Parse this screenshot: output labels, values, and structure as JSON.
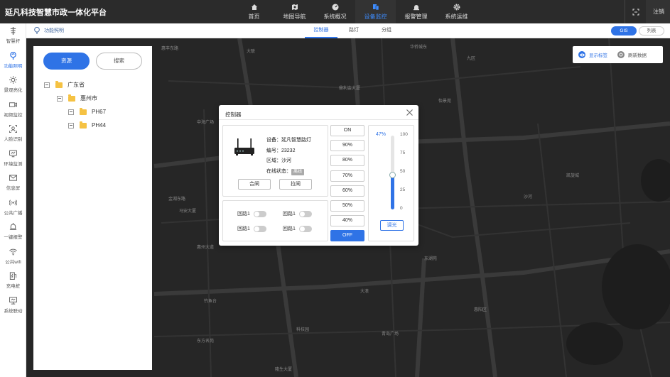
{
  "app": {
    "title": "延凡科技智慧市政一体化平台"
  },
  "nav": {
    "items": [
      {
        "label": "首页",
        "icon": "home-icon"
      },
      {
        "label": "地图导航",
        "icon": "map-pin-icon"
      },
      {
        "label": "系统概况",
        "icon": "gauge-icon"
      },
      {
        "label": "设备监控",
        "icon": "device-icon",
        "active": true
      },
      {
        "label": "报警管理",
        "icon": "alarm-icon"
      },
      {
        "label": "系统运维",
        "icon": "gear-icon"
      }
    ],
    "logout_label": "注销"
  },
  "sidebar": {
    "items": [
      {
        "label": "智慧杆",
        "icon": "pole-icon"
      },
      {
        "label": "功能照明",
        "icon": "lamp-icon",
        "active": true
      },
      {
        "label": "景观亮化",
        "icon": "sun-icon"
      },
      {
        "label": "视频监控",
        "icon": "camera-icon"
      },
      {
        "label": "人脸识别",
        "icon": "face-icon"
      },
      {
        "label": "环境监测",
        "icon": "monitor-icon"
      },
      {
        "label": "信息屏",
        "icon": "mail-icon"
      },
      {
        "label": "公共广播",
        "icon": "broadcast-icon"
      },
      {
        "label": "一键报警",
        "icon": "bell-icon"
      },
      {
        "label": "公共wifi",
        "icon": "wifi-icon"
      },
      {
        "label": "充电桩",
        "icon": "charger-icon"
      },
      {
        "label": "系统联动",
        "icon": "link-icon"
      }
    ]
  },
  "subbar": {
    "breadcrumb": "功能照明",
    "tabs": [
      {
        "label": "控制器",
        "active": true
      },
      {
        "label": "路灯"
      },
      {
        "label": "分组"
      }
    ],
    "view_gis": "GIS",
    "view_list": "列表"
  },
  "tree_panel": {
    "btn_resource": "资源",
    "btn_search": "搜索",
    "province": "广东省",
    "city": "惠州市",
    "nodes": [
      "PH67",
      "PH44"
    ]
  },
  "map_tools": {
    "show_label": "显示标签",
    "refresh": "刷新数据"
  },
  "map_labels": [
    "惠丰东路",
    "大联",
    "华侨城东",
    "九区",
    "鼎利金大厦",
    "怡景苑",
    "中海广场",
    "凯旋城",
    "沙河",
    "金湖东路",
    "马安大厦",
    "惠州大道",
    "钓鱼台",
    "科技园",
    "大浪",
    "青岛广场",
    "惠阳区",
    "东方名苑",
    "东湖苑",
    "隆生大厦"
  ],
  "dialog": {
    "title": "控制器",
    "device_label": "设备",
    "device_value": "延凡智慧路灯",
    "code_label": "编号",
    "code_value": "23232",
    "area_label": "区域",
    "area_value": "沙河",
    "online_label": "在线状态",
    "online_value": "离线",
    "btn_close_gate": "合闸",
    "btn_open_gate": "拉闸",
    "loops": [
      "回路1",
      "回路1",
      "回路1",
      "回路1"
    ],
    "levels": [
      "ON",
      "90%",
      "80%",
      "70%",
      "60%",
      "50%",
      "40%",
      "OFF"
    ],
    "brightness_pct": "47%",
    "brightness": 47,
    "ticks": [
      "100",
      "75",
      "50",
      "25",
      "0"
    ],
    "btn_dim": "调光"
  }
}
